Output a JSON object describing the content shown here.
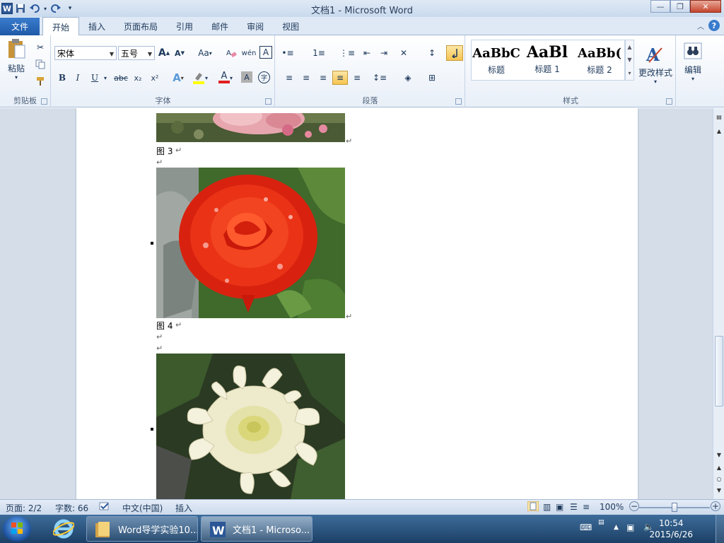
{
  "window": {
    "title": "文档1 - Microsoft Word",
    "min_label": "—",
    "max_label": "❐",
    "close_label": "✕"
  },
  "tabs": {
    "file": "文件",
    "items": [
      "开始",
      "插入",
      "页面布局",
      "引用",
      "邮件",
      "审阅",
      "视图"
    ],
    "active": "开始",
    "help": "?"
  },
  "ribbon": {
    "clipboard": {
      "label": "剪贴板",
      "paste": "粘贴"
    },
    "font": {
      "label": "字体",
      "font_name": "宋体",
      "font_size": "五号",
      "bold": "B",
      "italic": "I",
      "underline": "U",
      "strike": "abc",
      "subscript": "x₂",
      "superscript": "x²",
      "grow": "A",
      "shrink": "A",
      "case": "Aa",
      "pinyin": "wén",
      "border_char": "A",
      "effect": "A",
      "color": "A",
      "shade": "A",
      "enclose": "字"
    },
    "paragraph": {
      "label": "段落"
    },
    "styles": {
      "label": "样式",
      "items": [
        {
          "sample": "AaBbC",
          "name": "标题"
        },
        {
          "sample": "AaBl",
          "name": "标题 1"
        },
        {
          "sample": "AaBb(",
          "name": "标题 2"
        }
      ],
      "change_styles": "更改样式"
    },
    "editing": {
      "label": "编辑"
    }
  },
  "document": {
    "captions": [
      "图 3",
      "图 4"
    ],
    "para_mark": "↵",
    "images": [
      {
        "name": "pink-rose-photo",
        "subject": "pink roses"
      },
      {
        "name": "red-rose-photo",
        "subject": "red rose"
      },
      {
        "name": "white-chrysanthemum-photo",
        "subject": "white chrysanthemum"
      }
    ]
  },
  "statusbar": {
    "page": "页面: 2/2",
    "words": "字数: 66",
    "language": "中文(中国)",
    "mode": "插入",
    "zoom": "100%",
    "zoom_minus": "−",
    "zoom_plus": "+"
  },
  "taskbar": {
    "items": [
      {
        "label": "Word导学实验10...",
        "icon": "folder-icon"
      },
      {
        "label": "文档1 - Microso...",
        "icon": "word-icon"
      }
    ],
    "time": "10:54",
    "date": "2015/6/26"
  },
  "colors": {
    "accent": "#2b5797",
    "file_tab": "#1f5aa8",
    "ribbon_bg": "#e8eff8"
  }
}
